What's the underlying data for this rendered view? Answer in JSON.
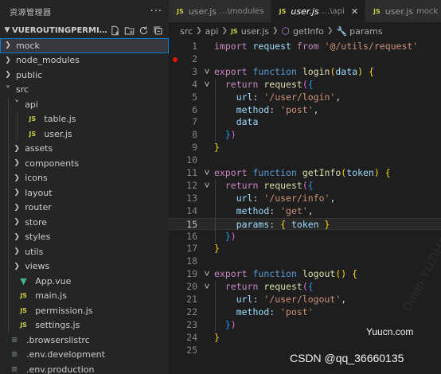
{
  "sidebar": {
    "title": "资源管理器",
    "more": "···",
    "project": "VUEROUTINGPERMISSIO...",
    "items": [
      {
        "label": "mock",
        "type": "folder",
        "depth": 0,
        "open": false,
        "selected": true
      },
      {
        "label": "node_modules",
        "type": "folder",
        "depth": 0,
        "open": false
      },
      {
        "label": "public",
        "type": "folder",
        "depth": 0,
        "open": false
      },
      {
        "label": "src",
        "type": "folder",
        "depth": 0,
        "open": true
      },
      {
        "label": "api",
        "type": "folder",
        "depth": 1,
        "open": true
      },
      {
        "label": "table.js",
        "type": "js",
        "depth": 2
      },
      {
        "label": "user.js",
        "type": "js",
        "depth": 2
      },
      {
        "label": "assets",
        "type": "folder",
        "depth": 1,
        "open": false
      },
      {
        "label": "components",
        "type": "folder",
        "depth": 1,
        "open": false
      },
      {
        "label": "icons",
        "type": "folder",
        "depth": 1,
        "open": false
      },
      {
        "label": "layout",
        "type": "folder",
        "depth": 1,
        "open": false
      },
      {
        "label": "router",
        "type": "folder",
        "depth": 1,
        "open": false
      },
      {
        "label": "store",
        "type": "folder",
        "depth": 1,
        "open": false
      },
      {
        "label": "styles",
        "type": "folder",
        "depth": 1,
        "open": false
      },
      {
        "label": "utils",
        "type": "folder",
        "depth": 1,
        "open": false
      },
      {
        "label": "views",
        "type": "folder",
        "depth": 1,
        "open": false
      },
      {
        "label": "App.vue",
        "type": "vue",
        "depth": 1
      },
      {
        "label": "main.js",
        "type": "js",
        "depth": 1
      },
      {
        "label": "permission.js",
        "type": "js",
        "depth": 1
      },
      {
        "label": "settings.js",
        "type": "js",
        "depth": 1
      },
      {
        "label": ".browserslistrc",
        "type": "cfg",
        "depth": 0
      },
      {
        "label": ".env.development",
        "type": "cfg",
        "depth": 0
      },
      {
        "label": ".env.production",
        "type": "cfg",
        "depth": 0
      }
    ]
  },
  "tabs": [
    {
      "label": "user.js",
      "desc": "...\\modules",
      "active": false
    },
    {
      "label": "user.js",
      "desc": "...\\api",
      "active": true
    },
    {
      "label": "user.js",
      "desc": "mock",
      "active": false
    }
  ],
  "breadcrumb": {
    "parts": [
      "src",
      "api",
      "user.js",
      "getInfo",
      "params"
    ]
  },
  "editor": {
    "current_line": 15,
    "breakpoint_line": 2,
    "lines": [
      [
        [
          "kw",
          "import"
        ],
        [
          "pl",
          " "
        ],
        [
          "var",
          "request"
        ],
        [
          "pl",
          " "
        ],
        [
          "kw",
          "from"
        ],
        [
          "pl",
          " "
        ],
        [
          "str",
          "'@/utils/request'"
        ]
      ],
      [],
      [
        [
          "kw",
          "export"
        ],
        [
          "pl",
          " "
        ],
        [
          "kb",
          "function"
        ],
        [
          "pl",
          " "
        ],
        [
          "fn",
          "login"
        ],
        [
          "p1",
          "("
        ],
        [
          "var",
          "data"
        ],
        [
          "p1",
          ")"
        ],
        [
          "pl",
          " "
        ],
        [
          "p1",
          "{"
        ]
      ],
      [
        [
          "pl",
          "  "
        ],
        [
          "kw",
          "return"
        ],
        [
          "pl",
          " "
        ],
        [
          "fn",
          "request"
        ],
        [
          "p2",
          "("
        ],
        [
          "p3",
          "{"
        ]
      ],
      [
        [
          "pl",
          "    "
        ],
        [
          "var",
          "url"
        ],
        [
          "pl",
          ": "
        ],
        [
          "str",
          "'/user/login'"
        ],
        [
          "pl",
          ","
        ]
      ],
      [
        [
          "pl",
          "    "
        ],
        [
          "var",
          "method"
        ],
        [
          "pl",
          ": "
        ],
        [
          "str",
          "'post'"
        ],
        [
          "pl",
          ","
        ]
      ],
      [
        [
          "pl",
          "    "
        ],
        [
          "var",
          "data"
        ]
      ],
      [
        [
          "pl",
          "  "
        ],
        [
          "p3",
          "}"
        ],
        [
          "p2",
          ")"
        ]
      ],
      [
        [
          "p1",
          "}"
        ]
      ],
      [],
      [
        [
          "kw",
          "export"
        ],
        [
          "pl",
          " "
        ],
        [
          "kb",
          "function"
        ],
        [
          "pl",
          " "
        ],
        [
          "fn",
          "getInfo"
        ],
        [
          "p1",
          "("
        ],
        [
          "var",
          "token"
        ],
        [
          "p1",
          ")"
        ],
        [
          "pl",
          " "
        ],
        [
          "p1",
          "{"
        ]
      ],
      [
        [
          "pl",
          "  "
        ],
        [
          "kw",
          "return"
        ],
        [
          "pl",
          " "
        ],
        [
          "fn",
          "request"
        ],
        [
          "p2",
          "("
        ],
        [
          "p3",
          "{"
        ]
      ],
      [
        [
          "pl",
          "    "
        ],
        [
          "var",
          "url"
        ],
        [
          "pl",
          ": "
        ],
        [
          "str",
          "'/user/info'"
        ],
        [
          "pl",
          ","
        ]
      ],
      [
        [
          "pl",
          "    "
        ],
        [
          "var",
          "method"
        ],
        [
          "pl",
          ": "
        ],
        [
          "str",
          "'get'"
        ],
        [
          "pl",
          ","
        ]
      ],
      [
        [
          "pl",
          "    "
        ],
        [
          "var",
          "params"
        ],
        [
          "pl",
          ": "
        ],
        [
          "p1",
          "{"
        ],
        [
          "pl",
          " "
        ],
        [
          "var",
          "token"
        ],
        [
          "pl",
          " "
        ],
        [
          "p1",
          "}"
        ]
      ],
      [
        [
          "pl",
          "  "
        ],
        [
          "p3",
          "}"
        ],
        [
          "p2",
          ")"
        ]
      ],
      [
        [
          "p1",
          "}"
        ]
      ],
      [],
      [
        [
          "kw",
          "export"
        ],
        [
          "pl",
          " "
        ],
        [
          "kb",
          "function"
        ],
        [
          "pl",
          " "
        ],
        [
          "fn",
          "logout"
        ],
        [
          "p1",
          "("
        ],
        [
          "p1",
          ")"
        ],
        [
          "pl",
          " "
        ],
        [
          "p1",
          "{"
        ]
      ],
      [
        [
          "pl",
          "  "
        ],
        [
          "kw",
          "return"
        ],
        [
          "pl",
          " "
        ],
        [
          "fn",
          "request"
        ],
        [
          "p2",
          "("
        ],
        [
          "p3",
          "{"
        ]
      ],
      [
        [
          "pl",
          "    "
        ],
        [
          "var",
          "url"
        ],
        [
          "pl",
          ": "
        ],
        [
          "str",
          "'/user/logout'"
        ],
        [
          "pl",
          ","
        ]
      ],
      [
        [
          "pl",
          "    "
        ],
        [
          "var",
          "method"
        ],
        [
          "pl",
          ": "
        ],
        [
          "str",
          "'post'"
        ]
      ],
      [
        [
          "pl",
          "  "
        ],
        [
          "p3",
          "}"
        ],
        [
          "p2",
          ")"
        ]
      ],
      [
        [
          "p1",
          "}"
        ]
      ],
      []
    ],
    "fold_lines": [
      3,
      4,
      11,
      12,
      19,
      20
    ]
  },
  "watermarks": {
    "site": "Yuucn.com",
    "author": "CSDN @qq_36660135"
  }
}
